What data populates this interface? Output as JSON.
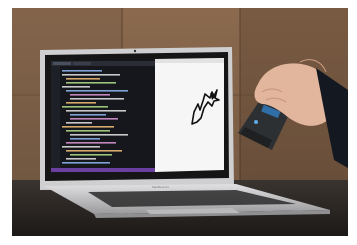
{
  "scene": {
    "laptop_brand_text": "MacBook Air",
    "colors": {
      "wall_wood": "#8b6a4e",
      "wall_wood_light": "#a07a58",
      "desk": "#2b2623",
      "laptop_silver": "#cfcfd1",
      "screen_bezel": "#151515",
      "editor_bg": "#15171d",
      "canvas_bg": "#f6f6f6",
      "device_body": "#2d3033",
      "device_accent": "#2f6ea6",
      "skin": "#e2b59d",
      "sleeve": "#141820"
    }
  }
}
